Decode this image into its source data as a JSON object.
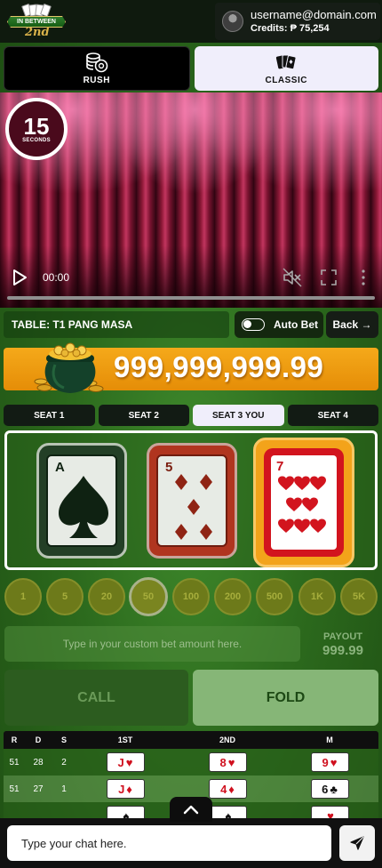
{
  "header": {
    "logo_text": "IN BETWEEN",
    "logo_script": "2nd",
    "username": "username@domain.com",
    "credits": "Credits: ₱ 75,254"
  },
  "modes": [
    {
      "label": "RUSH",
      "icon": "chips-icon",
      "active": false
    },
    {
      "label": "CLASSIC",
      "icon": "cards-icon",
      "active": true
    }
  ],
  "video": {
    "countdown": "15",
    "countdown_unit": "SECONDS",
    "time": "00:00"
  },
  "table": {
    "name": "TABLE: T1 PANG MASA",
    "autobet_label": "Auto Bet",
    "back_label": "Back →"
  },
  "jackpot": {
    "amount": "999,999,999.99"
  },
  "seats": [
    {
      "label": "SEAT 1",
      "active": false
    },
    {
      "label": "SEAT 2",
      "active": false
    },
    {
      "label": "SEAT 3 YOU",
      "active": true
    },
    {
      "label": "SEAT 4",
      "active": false
    }
  ],
  "cards": [
    {
      "rank": "A",
      "suit": "spade",
      "frame": "#233f26",
      "inner_border": "#0f2212"
    },
    {
      "rank": "5",
      "suit": "diamond",
      "frame": "#b0351f",
      "inner_border": "#6e1c0f"
    },
    {
      "rank": "7",
      "suit": "heart",
      "frame": "#f3a31a",
      "inner_border": "#d2141e"
    }
  ],
  "chips": [
    {
      "label": "1",
      "selected": false
    },
    {
      "label": "5",
      "selected": false
    },
    {
      "label": "20",
      "selected": false
    },
    {
      "label": "50",
      "selected": true
    },
    {
      "label": "100",
      "selected": false
    },
    {
      "label": "200",
      "selected": false
    },
    {
      "label": "500",
      "selected": false
    },
    {
      "label": "1K",
      "selected": false
    },
    {
      "label": "5K",
      "selected": false
    }
  ],
  "bet": {
    "placeholder": "Type in your custom bet amount here.",
    "payout_label": "PAYOUT",
    "payout_value": "999.99"
  },
  "actions": {
    "call": "CALL",
    "fold": "FOLD"
  },
  "history": {
    "headers": [
      "R",
      "D",
      "S",
      "1ST",
      "2ND",
      "M"
    ],
    "rows": [
      {
        "r": "51",
        "d": "28",
        "s": "2",
        "first": {
          "rank": "J",
          "suit": "♥",
          "color": "red"
        },
        "second": {
          "rank": "8",
          "suit": "♥",
          "color": "red"
        },
        "m": {
          "rank": "9",
          "suit": "♥",
          "color": "red"
        }
      },
      {
        "r": "51",
        "d": "27",
        "s": "1",
        "first": {
          "rank": "J",
          "suit": "♦",
          "color": "red"
        },
        "second": {
          "rank": "4",
          "suit": "♦",
          "color": "red"
        },
        "m": {
          "rank": "6",
          "suit": "♣",
          "color": "black"
        }
      },
      {
        "r": "",
        "d": "",
        "s": "",
        "first": {
          "rank": "",
          "suit": "♠",
          "color": "black"
        },
        "second": {
          "rank": "",
          "suit": "♠",
          "color": "black"
        },
        "m": {
          "rank": "",
          "suit": "♥",
          "color": "red"
        }
      }
    ]
  },
  "chat": {
    "placeholder": "Type your chat here."
  }
}
